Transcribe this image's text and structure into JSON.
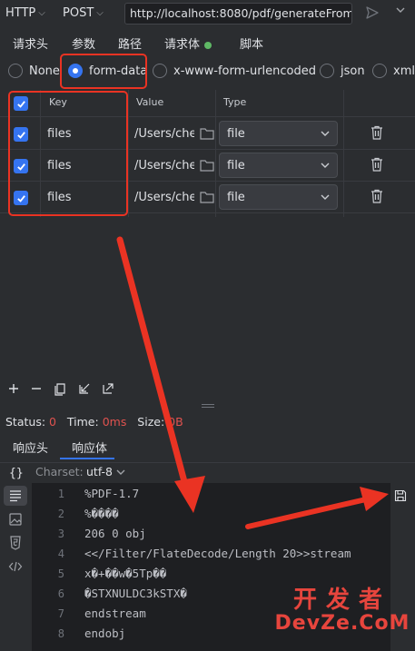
{
  "request": {
    "protocol": "HTTP",
    "method": "POST",
    "url": "http://localhost:8080/pdf/generateFrom"
  },
  "tabs": [
    {
      "label": "请求头"
    },
    {
      "label": "参数"
    },
    {
      "label": "路径"
    },
    {
      "label": "请求体"
    },
    {
      "label": "脚本"
    }
  ],
  "body_types": [
    {
      "label": "None",
      "selected": false
    },
    {
      "label": "form-data",
      "selected": true
    },
    {
      "label": "x-www-form-urlencoded",
      "selected": false
    },
    {
      "label": "json",
      "selected": false
    },
    {
      "label": "xml",
      "selected": false
    }
  ],
  "table": {
    "headers": {
      "key": "Key",
      "value": "Value",
      "type": "Type"
    },
    "rows": [
      {
        "key": "files",
        "value": "/Users/che",
        "type": "file",
        "checked": true
      },
      {
        "key": "files",
        "value": "/Users/che",
        "type": "file",
        "checked": true
      },
      {
        "key": "files",
        "value": "/Users/che",
        "type": "file",
        "checked": true
      }
    ]
  },
  "status": {
    "status_label": "Status:",
    "status_value": "0",
    "time_label": "Time:",
    "time_value": "0ms",
    "size_label": "Size:",
    "size_value": "0B"
  },
  "response_tabs": [
    {
      "label": "响应头"
    },
    {
      "label": "响应体"
    }
  ],
  "charset": {
    "label": "Charset:",
    "value": "utf-8"
  },
  "editor": {
    "lines": [
      {
        "n": "1",
        "text": "%PDF-1.7"
      },
      {
        "n": "2",
        "text": "%����"
      },
      {
        "n": "3",
        "text": "206 0 obj"
      },
      {
        "n": "4",
        "text": "<</Filter/FlateDecode/Length 20>>stream"
      },
      {
        "n": "5",
        "text": "x�+��w�5Tp��"
      },
      {
        "n": "6",
        "text": "�STXNULDC3kSTX�"
      },
      {
        "n": "7",
        "text": "endstream"
      },
      {
        "n": "8",
        "text": "endobj"
      }
    ]
  },
  "watermark": {
    "cn": "开发者",
    "en": "DevZe.CoM"
  },
  "colors": {
    "accent": "#3574f0",
    "annotation": "#ea3323",
    "success": "#5fb865",
    "error": "#e0524f"
  }
}
